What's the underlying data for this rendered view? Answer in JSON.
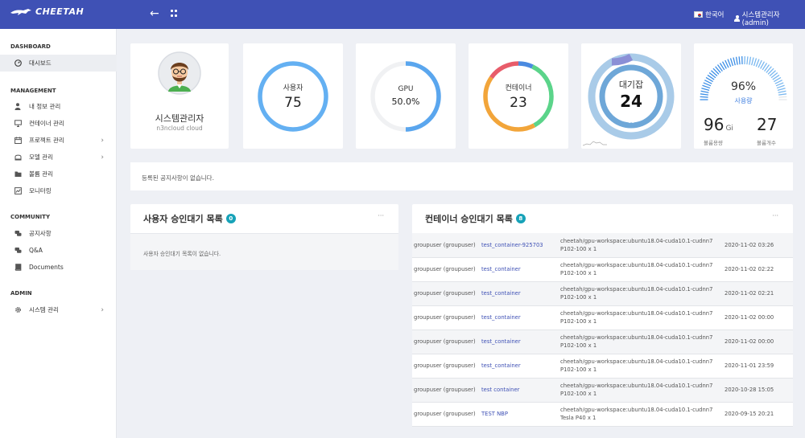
{
  "topbar": {
    "logo": "CHEETAH",
    "language": "한국어",
    "user": "시스템관리자 (admin)"
  },
  "sidebar": {
    "sections": [
      {
        "title": "DASHBOARD",
        "items": [
          {
            "label": "대시보드",
            "icon": "dashboard-icon",
            "active": true
          }
        ]
      },
      {
        "title": "MANAGEMENT",
        "items": [
          {
            "label": "내 정보 관리",
            "icon": "user-icon"
          },
          {
            "label": "컨테이너 관리",
            "icon": "monitor-icon"
          },
          {
            "label": "프로젝트 관리",
            "icon": "calendar-icon",
            "has_sub": true
          },
          {
            "label": "모델 관리",
            "icon": "model-icon",
            "has_sub": true
          },
          {
            "label": "볼륨 관리",
            "icon": "folder-icon"
          },
          {
            "label": "모니터링",
            "icon": "chart-icon"
          }
        ]
      },
      {
        "title": "COMMUNITY",
        "items": [
          {
            "label": "공지사항",
            "icon": "comments-icon"
          },
          {
            "label": "Q&A",
            "icon": "comments-icon"
          },
          {
            "label": "Documents",
            "icon": "book-icon"
          }
        ]
      },
      {
        "title": "ADMIN",
        "items": [
          {
            "label": "시스템 관리",
            "icon": "gear-icon",
            "has_sub": true
          }
        ]
      }
    ]
  },
  "profile": {
    "name": "시스템관리자",
    "org": "n3ncloud cloud"
  },
  "stats": {
    "users": {
      "label": "사용자",
      "value": "75",
      "color": "#64b0f2"
    },
    "gpu": {
      "label": "GPU",
      "value": "50.0%",
      "fraction": 0.5,
      "color": "#5aa6ee"
    },
    "containers": {
      "label": "컨테이너",
      "value": "23",
      "colors": [
        "#5bd48a",
        "#f2a53a",
        "#e85c6a",
        "#4a8ae0"
      ]
    },
    "waiting": {
      "label": "대기잡",
      "value": "24",
      "ring_text": "OC"
    },
    "usage": {
      "percent": "96%",
      "percent_label": "사용량",
      "fraction": 0.96,
      "volume_value": "96",
      "volume_unit": "Gi",
      "volume_label": "볼륨용량",
      "count_value": "27",
      "count_label": "볼륨개수"
    }
  },
  "notice": {
    "text": "등록된 공지사항이 없습니다."
  },
  "user_pending": {
    "title": "사용자 승인대기 목록",
    "count": "0",
    "empty": "사용자 승인대기 목록이 없습니다.",
    "more": "···"
  },
  "container_pending": {
    "title": "컨테이너 승인대기 목록",
    "count": "8",
    "more": "···",
    "rows": [
      {
        "user": "groupuser (groupuser)",
        "name": "test_container-925703",
        "image": "cheetah/gpu-workspace:ubuntu18.04-cuda10.1-cudnn7",
        "spec": "P102-100 x 1",
        "date": "2020-11-02 03:26"
      },
      {
        "user": "groupuser (groupuser)",
        "name": "test_container",
        "image": "cheetah/gpu-workspace:ubuntu18.04-cuda10.1-cudnn7",
        "spec": "P102-100 x 1",
        "date": "2020-11-02 02:22"
      },
      {
        "user": "groupuser (groupuser)",
        "name": "test_container",
        "image": "cheetah/gpu-workspace:ubuntu18.04-cuda10.1-cudnn7",
        "spec": "P102-100 x 1",
        "date": "2020-11-02 02:21"
      },
      {
        "user": "groupuser (groupuser)",
        "name": "test_container",
        "image": "cheetah/gpu-workspace:ubuntu18.04-cuda10.1-cudnn7",
        "spec": "P102-100 x 1",
        "date": "2020-11-02 00:00"
      },
      {
        "user": "groupuser (groupuser)",
        "name": "test_container",
        "image": "cheetah/gpu-workspace:ubuntu18.04-cuda10.1-cudnn7",
        "spec": "P102-100 x 1",
        "date": "2020-11-02 00:00"
      },
      {
        "user": "groupuser (groupuser)",
        "name": "test_container",
        "image": "cheetah/gpu-workspace:ubuntu18.04-cuda10.1-cudnn7",
        "spec": "P102-100 x 1",
        "date": "2020-11-01 23:59"
      },
      {
        "user": "groupuser (groupuser)",
        "name": "test container",
        "image": "cheetah/gpu-workspace:ubuntu18.04-cuda10.1-cudnn7",
        "spec": "P102-100 x 1",
        "date": "2020-10-28 15:05"
      },
      {
        "user": "groupuser (groupuser)",
        "name": "TEST NBP",
        "image": "cheetah/gpu-workspace:ubuntu18.04-cuda10.1-cudnn7",
        "spec": "Tesla P40 x 1",
        "date": "2020-09-15 20:21"
      }
    ]
  }
}
